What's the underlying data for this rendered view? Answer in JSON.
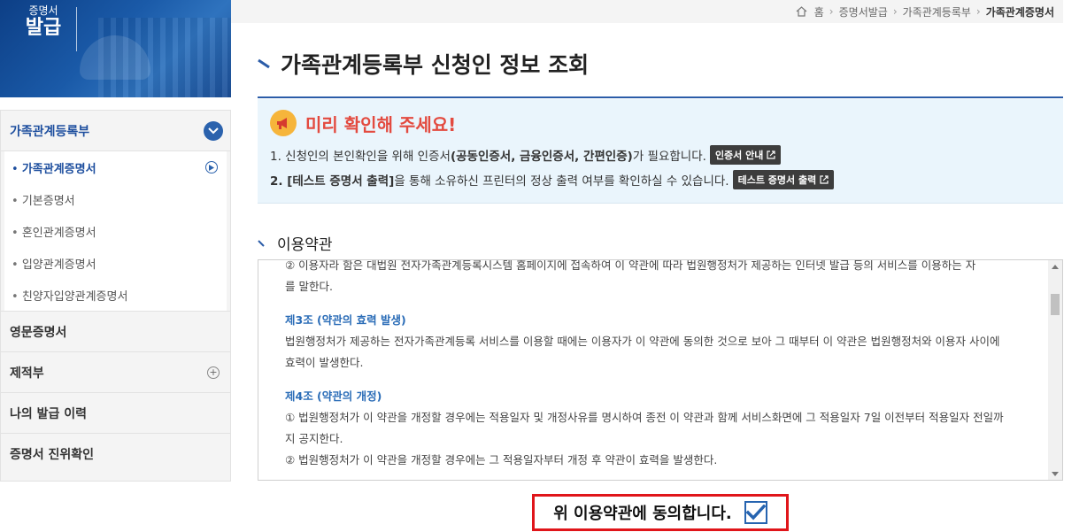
{
  "banner": {
    "title_line1": "증명서",
    "title_line2": "발급"
  },
  "sidebar": {
    "section_title": "가족관계등록부",
    "sub_items": [
      {
        "label": "가족관계증명서"
      },
      {
        "label": "기본증명서"
      },
      {
        "label": "혼인관계증명서"
      },
      {
        "label": "입양관계증명서"
      },
      {
        "label": "친양자입양관계증명서"
      }
    ],
    "items": [
      {
        "label": "영문증명서"
      },
      {
        "label": "제적부"
      },
      {
        "label": "나의 발급 이력"
      },
      {
        "label": "증명서 진위확인"
      }
    ]
  },
  "breadcrumb": [
    "홈",
    "증명서발급",
    "가족관계등록부",
    "가족관계증명서"
  ],
  "page_title": "가족관계등록부 신청인 정보 조회",
  "notice": {
    "title": "미리 확인해 주세요!",
    "line1_pre": "1. 신청인의 본인확인을 위해 인증서",
    "line1_bold": "(공동인증서, 금융인증서, 간편인증)",
    "line1_post": "가 필요합니다.",
    "cert_button": "인증서 안내",
    "line2_bold": "2. [테스트 증명서 출력]",
    "line2_post": "을 통해 소유하신 프린터의 정상 출력 여부를 확인하실 수 있습니다.",
    "test_button": "테스트 증명서 출력"
  },
  "terms": {
    "section_title": "이용약관",
    "lines": {
      "l0": "② 이용자라 함은 대법원 전자가족관계등록시스템 홈페이지에 접속하여 이 약관에 따라 법원행정처가 제공하는 인터넷 발급 등의 서비스를 이용하는 자",
      "l1": "를 말한다.",
      "art3": "제3조 (약관의 효력 발생)",
      "l3a": "법원행정처가 제공하는 전자가족관계등록 서비스를 이용할 때에는 이용자가 이 약관에 동의한 것으로 보아 그 때부터 이 약관은 법원행정처와 이용자 사이에",
      "l3b": "효력이 발생한다.",
      "art4": "제4조 (약관의 개정)",
      "l4a": "① 법원행정처가 이 약관을 개정할 경우에는 적용일자 및 개정사유를 명시하여 종전 이 약관과 함께 서비스화면에 그 적용일자 7일 이전부터 적용일자 전일까",
      "l4b": "지 공지한다.",
      "l4c": "② 법원행정처가 이 약관을 개정할 경우에는 그 적용일자부터 개정 후 약관이 효력을 발생한다."
    }
  },
  "agree": {
    "label": "위 이용약관에 동의합니다.",
    "checked": true
  },
  "colors": {
    "primary": "#2b62ad",
    "accent_red": "#e34a3f",
    "highlight_border": "#e0151a",
    "notice_bg": "#eaf5fc"
  }
}
